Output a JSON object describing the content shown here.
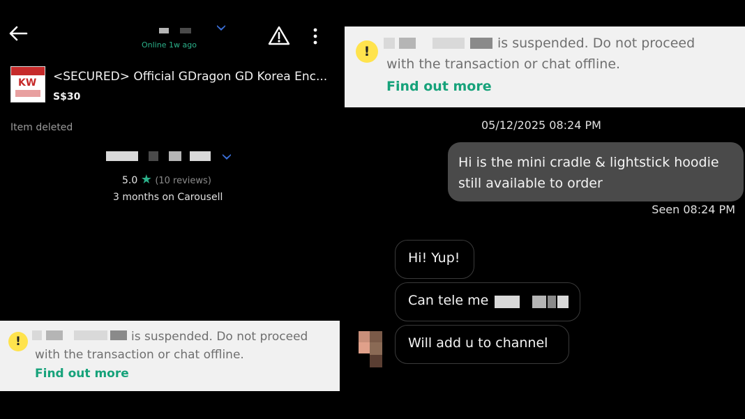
{
  "left": {
    "header": {
      "back_icon": "arrow-left-icon",
      "subtitle": "Online 1w ago",
      "report_icon": "warning-triangle-icon",
      "more_icon": "more-vert-icon"
    },
    "listing": {
      "title": "<SECURED> Official GDragon GD Korea Enc...",
      "price": "S$30",
      "status": "Item deleted"
    },
    "seller": {
      "rating": "5.0",
      "reviews": "(10 reviews)",
      "tenure": "3 months on Carousell"
    },
    "banner": {
      "text_line1": "is suspended. Do not proceed",
      "text_line2": "with the transaction or chat offline.",
      "link": "Find out more"
    }
  },
  "right": {
    "banner": {
      "text_line1": "is suspended. Do not proceed",
      "text_line2": "with the transaction or chat offline.",
      "link": "Find out more"
    },
    "chat": {
      "date": "05/12/2025 08:24 PM",
      "outgoing_line1": "Hi is the mini cradle & lightstick hoodie",
      "outgoing_line2": "still available to order",
      "seen": "Seen 08:24 PM",
      "incoming": [
        "Hi! Yup!",
        "Can tele me",
        "Will add u to channel"
      ]
    }
  },
  "colors": {
    "accent_green": "#2bb18a",
    "link_green": "#16a27a",
    "warning_yellow": "#ffe34d",
    "banner_bg": "#f1f1f1"
  }
}
